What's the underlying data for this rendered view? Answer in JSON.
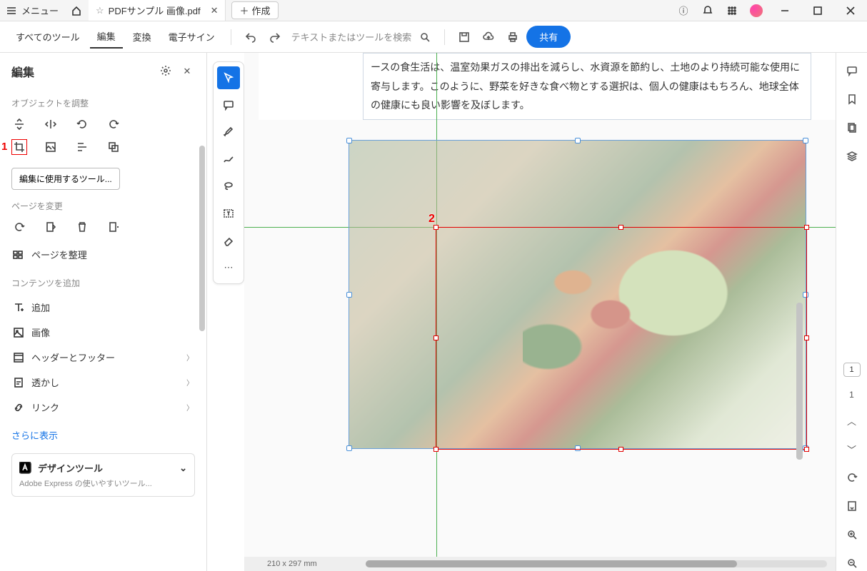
{
  "titlebar": {
    "menu": "メニュー",
    "tab_title": "PDFサンプル 画像.pdf",
    "new_tab": "作成"
  },
  "topbar": {
    "all_tools": "すべてのツール",
    "edit": "編集",
    "convert": "変換",
    "esign": "電子サイン",
    "search_placeholder": "テキストまたはツールを検索",
    "share": "共有"
  },
  "left": {
    "title": "編集",
    "adjust_label": "オブジェクトを調整",
    "tool_button": "編集に使用するツール...",
    "change_page": "ページを変更",
    "organize": "ページを整理",
    "add_content": "コンテンツを追加",
    "add": "追加",
    "image": "画像",
    "header_footer": "ヘッダーとフッター",
    "watermark": "透かし",
    "link": "リンク",
    "more": "さらに表示",
    "design_title": "デザインツール",
    "design_sub": "Adobe Express の使いやすいツール..."
  },
  "annotations": {
    "a1": "1",
    "a2": "2"
  },
  "doc": {
    "paragraph": "ースの食生活は、温室効果ガスの排出を減らし、水資源を節約し、土地のより持続可能な使用に寄与します。このように、野菜を好きな食べ物とする選択は、個人の健康はもちろん、地球全体の健康にも良い影響を及ぼします。",
    "status": "210 x 297 mm"
  },
  "right": {
    "page_box": "1",
    "page_num": "1"
  }
}
